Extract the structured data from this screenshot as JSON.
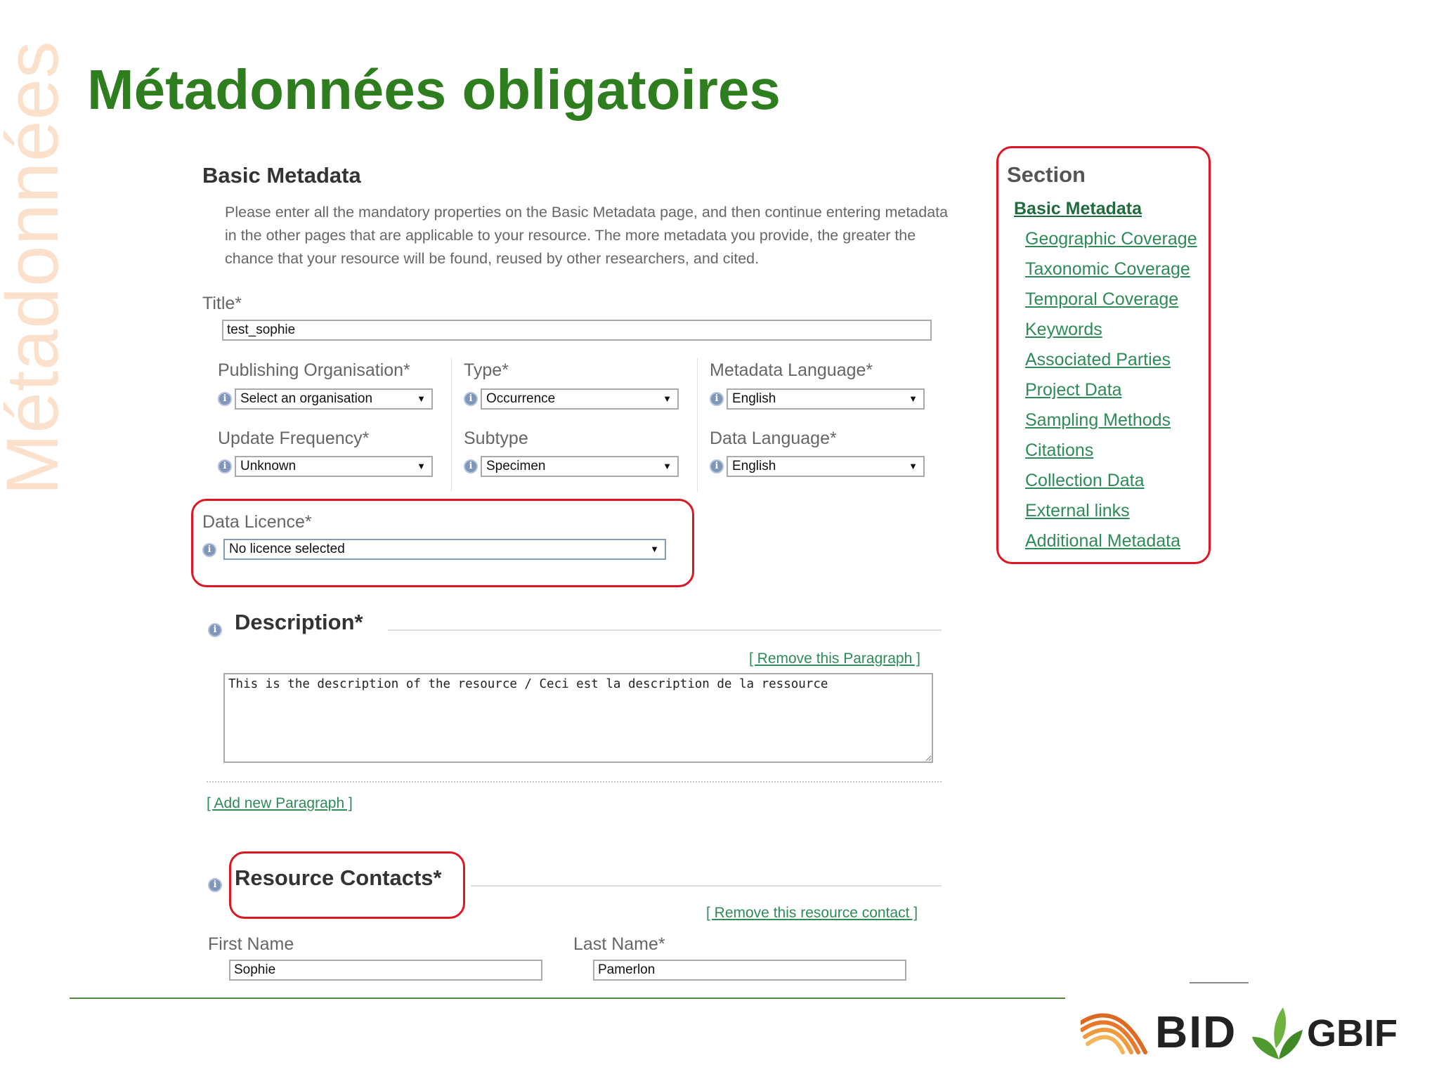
{
  "slide": {
    "title": "Métadonnées obligatoires",
    "side_label": "Métadonnées"
  },
  "form": {
    "heading": "Basic Metadata",
    "intro": "Please enter all the mandatory properties on the Basic Metadata page, and then continue entering metadata in the other pages that are applicable to your resource. The more metadata you provide, the greater the chance that your resource will be found, reused by other researchers, and cited.",
    "title_label": "Title*",
    "title_value": "test_sophie",
    "publishing_org": {
      "label": "Publishing Organisation*",
      "value": "Select an organisation"
    },
    "type": {
      "label": "Type*",
      "value": "Occurrence"
    },
    "metadata_language": {
      "label": "Metadata Language*",
      "value": "English"
    },
    "update_frequency": {
      "label": "Update Frequency*",
      "value": "Unknown"
    },
    "subtype": {
      "label": "Subtype",
      "value": "Specimen"
    },
    "data_language": {
      "label": "Data Language*",
      "value": "English"
    },
    "data_licence": {
      "label": "Data Licence*",
      "value": "No licence selected"
    },
    "description": {
      "heading": "Description*",
      "remove_link": "[ Remove this Paragraph ]",
      "value": "This is the description of the resource / Ceci est la description de la ressource",
      "add_link": "[ Add new Paragraph ]"
    },
    "contacts": {
      "heading": "Resource Contacts*",
      "remove_link": "[ Remove this resource contact ]",
      "first_name_label": "First Name",
      "first_name_value": "Sophie",
      "last_name_label": "Last Name*",
      "last_name_value": "Pamerlon"
    }
  },
  "section_nav": {
    "title": "Section",
    "items": [
      "Basic Metadata",
      "Geographic Coverage",
      "Taxonomic Coverage",
      "Temporal Coverage",
      "Keywords",
      "Associated Parties",
      "Project Data",
      "Sampling Methods",
      "Citations",
      "Collection Data",
      "External links",
      "Additional Metadata"
    ]
  },
  "logos": {
    "bid": "BID",
    "gbif": "GBIF"
  },
  "icons": {
    "info": "info-icon",
    "dropdown": "dropdown-arrow-icon",
    "bid_logo": "bid-waves-icon",
    "gbif_logo": "gbif-leaf-icon"
  },
  "colors": {
    "title_green": "#2e7d1f",
    "highlight_red": "#e01523",
    "link_green": "#2e8b57",
    "bid_orange": "#e8792b",
    "gbif_green": "#4e9a2e"
  }
}
